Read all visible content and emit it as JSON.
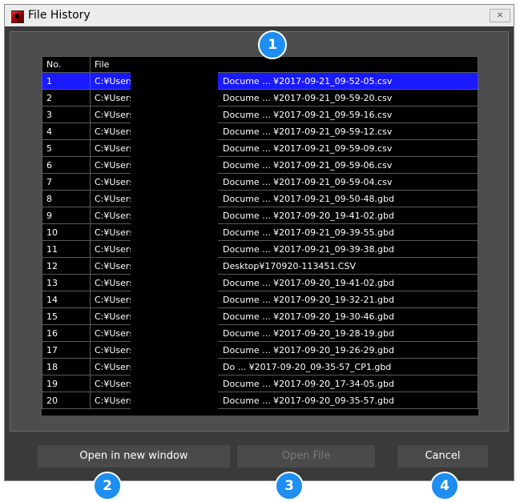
{
  "window": {
    "title": "File History",
    "close_glyph": "⨯"
  },
  "table": {
    "headers": [
      "No.",
      "File"
    ],
    "rows": [
      {
        "no": "1",
        "left": "C:¥Users¥",
        "right": "Docume ... ¥2017-09-21_09-52-05.csv",
        "selected": true
      },
      {
        "no": "2",
        "left": "C:¥Users¥",
        "right": "Docume ... ¥2017-09-21_09-59-20.csv"
      },
      {
        "no": "3",
        "left": "C:¥Users¥",
        "right": "Docume ... ¥2017-09-21_09-59-16.csv"
      },
      {
        "no": "4",
        "left": "C:¥Users¥",
        "right": "Docume ... ¥2017-09-21_09-59-12.csv"
      },
      {
        "no": "5",
        "left": "C:¥Users¥",
        "right": "Docume ... ¥2017-09-21_09-59-09.csv"
      },
      {
        "no": "6",
        "left": "C:¥Users¥",
        "right": "Docume ... ¥2017-09-21_09-59-06.csv"
      },
      {
        "no": "7",
        "left": "C:¥Users¥",
        "right": "Docume ... ¥2017-09-21_09-59-04.csv"
      },
      {
        "no": "8",
        "left": "C:¥Users¥",
        "right": "Docume ... ¥2017-09-21_09-50-48.gbd"
      },
      {
        "no": "9",
        "left": "C:¥Users¥",
        "right": "Docume ... ¥2017-09-20_19-41-02.gbd"
      },
      {
        "no": "10",
        "left": "C:¥Users¥",
        "right": "Docume ... ¥2017-09-21_09-39-55.gbd"
      },
      {
        "no": "11",
        "left": "C:¥Users¥",
        "right": "Docume ... ¥2017-09-21_09-39-38.gbd"
      },
      {
        "no": "12",
        "left": "C:¥Users¥",
        "right": "Desktop¥170920-113451.CSV"
      },
      {
        "no": "13",
        "left": "C:¥Users¥",
        "right": "Docume ... ¥2017-09-20_19-41-02.gbd"
      },
      {
        "no": "14",
        "left": "C:¥Users¥",
        "right": "Docume ... ¥2017-09-20_19-32-21.gbd"
      },
      {
        "no": "15",
        "left": "C:¥Users¥",
        "right": "Docume ... ¥2017-09-20_19-30-46.gbd"
      },
      {
        "no": "16",
        "left": "C:¥Users¥",
        "right": "Docume ... ¥2017-09-20_19-28-19.gbd"
      },
      {
        "no": "17",
        "left": "C:¥Users¥",
        "right": "Docume ... ¥2017-09-20_19-26-29.gbd"
      },
      {
        "no": "18",
        "left": "C:¥Users¥",
        "right": "Do ... ¥2017-09-20_09-35-57_CP1.gbd"
      },
      {
        "no": "19",
        "left": "C:¥Users¥",
        "right": "Docume ... ¥2017-09-20_17-34-05.gbd"
      },
      {
        "no": "20",
        "left": "C:¥Users¥",
        "right": "Docume ... ¥2017-09-20_09-35-57.gbd"
      }
    ]
  },
  "buttons": {
    "open_new_window": "Open in new window",
    "open_file": "Open File",
    "cancel": "Cancel"
  },
  "callouts": [
    "1",
    "2",
    "3",
    "4"
  ],
  "colors": {
    "selection": "#1a1aff",
    "callout": "#1e8ef0"
  }
}
